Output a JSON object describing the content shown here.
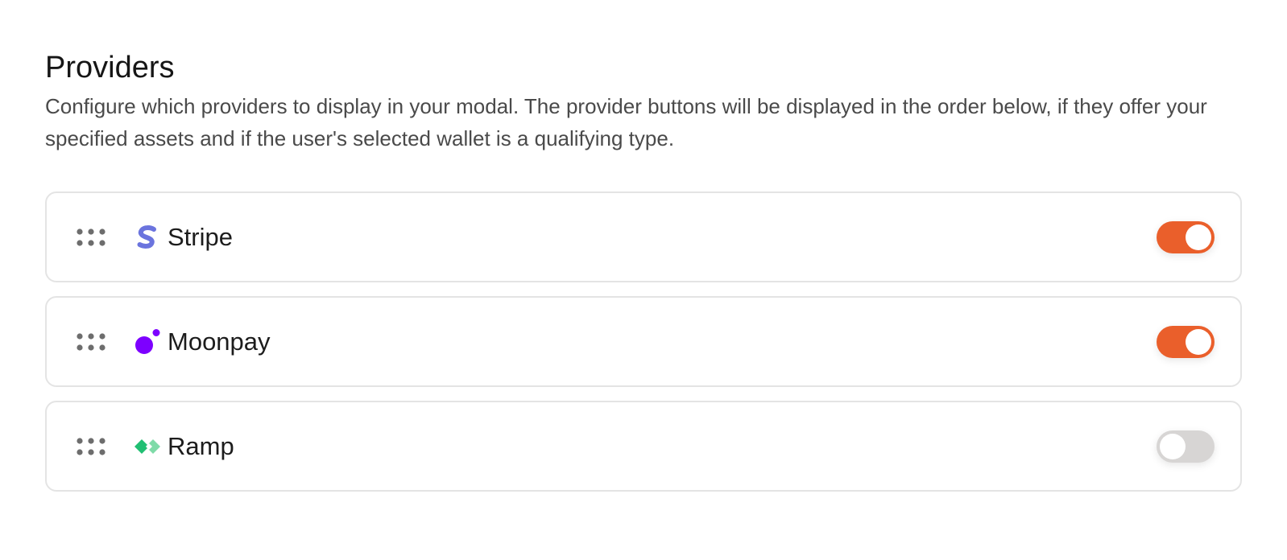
{
  "section": {
    "title": "Providers",
    "description": "Configure which providers to display in your modal. The provider buttons will be displayed in the order below, if they offer your specified assets and if the user's selected wallet is a qualifying type."
  },
  "providers": [
    {
      "name": "Stripe",
      "icon": "stripe-logo-icon",
      "enabled": true,
      "brand_color": "#6b74de"
    },
    {
      "name": "Moonpay",
      "icon": "moonpay-logo-icon",
      "enabled": true,
      "brand_color": "#7d00ff"
    },
    {
      "name": "Ramp",
      "icon": "ramp-logo-icon",
      "enabled": false,
      "brand_color": "#21bf73"
    }
  ],
  "colors": {
    "toggle_on": "#ea5f2b",
    "toggle_off": "#d7d5d4",
    "border": "#e4e4e4"
  }
}
